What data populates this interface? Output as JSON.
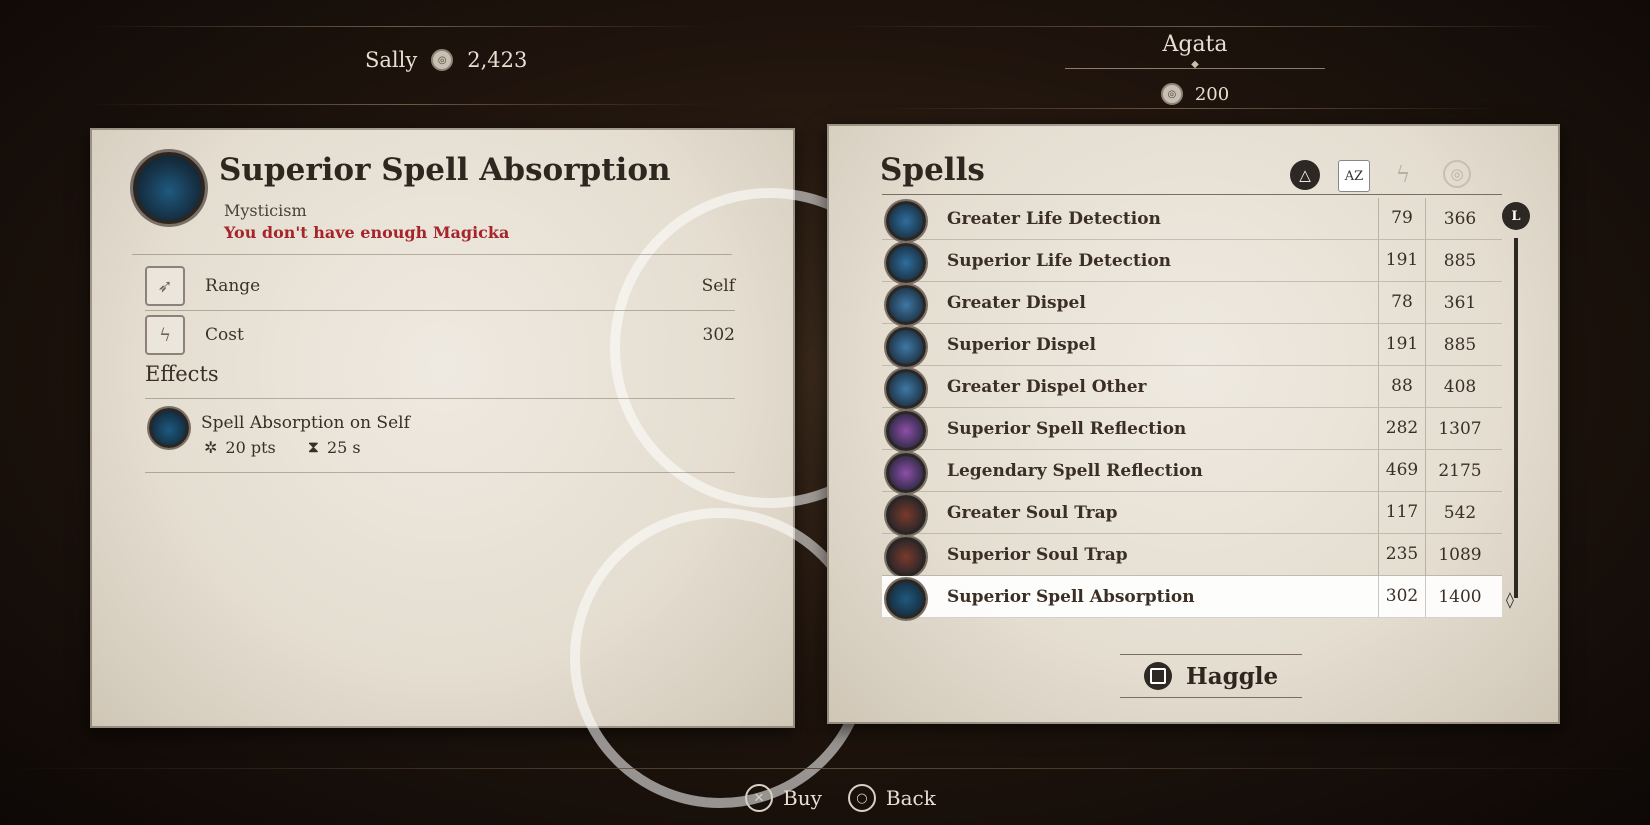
{
  "player": {
    "name": "Sally",
    "gold": "2,423"
  },
  "merchant": {
    "name": "Agata",
    "gold": "200"
  },
  "item": {
    "title": "Superior Spell Absorption",
    "school": "Mysticism",
    "warning": "You don't have enough Magicka",
    "stats": [
      {
        "label": "Range",
        "value": "Self"
      },
      {
        "label": "Cost",
        "value": "302"
      }
    ],
    "effects_title": "Effects",
    "effect": {
      "name": "Spell Absorption on Self",
      "magnitude": "20 pts",
      "duration": "25 s"
    }
  },
  "spells": {
    "title": "Spells",
    "sort": {
      "alpha_label": "AZ"
    },
    "scroll_label": "L",
    "items": [
      {
        "name": "Greater Life Detection",
        "cost": "79",
        "price": "366",
        "color": "#2f6e9e"
      },
      {
        "name": "Superior Life Detection",
        "cost": "191",
        "price": "885",
        "color": "#2f6e9e"
      },
      {
        "name": "Greater Dispel",
        "cost": "78",
        "price": "361",
        "color": "#3f78a6"
      },
      {
        "name": "Superior Dispel",
        "cost": "191",
        "price": "885",
        "color": "#3f78a6"
      },
      {
        "name": "Greater Dispel Other",
        "cost": "88",
        "price": "408",
        "color": "#3f78a6"
      },
      {
        "name": "Superior Spell Reflection",
        "cost": "282",
        "price": "1307",
        "color": "#8e4fa8"
      },
      {
        "name": "Legendary Spell Reflection",
        "cost": "469",
        "price": "2175",
        "color": "#8e4fa8"
      },
      {
        "name": "Greater Soul Trap",
        "cost": "117",
        "price": "542",
        "color": "#7a3a2a"
      },
      {
        "name": "Superior Soul Trap",
        "cost": "235",
        "price": "1089",
        "color": "#7a3a2a"
      },
      {
        "name": "Superior Spell Absorption",
        "cost": "302",
        "price": "1400",
        "color": "#1f5a80",
        "selected": true
      }
    ]
  },
  "haggle_label": "Haggle",
  "footer": {
    "buy": "Buy",
    "back": "Back"
  },
  "colors": {
    "warning": "#a5252b",
    "selected_row": "#ffffff",
    "parchment": "#e8e2d6"
  }
}
